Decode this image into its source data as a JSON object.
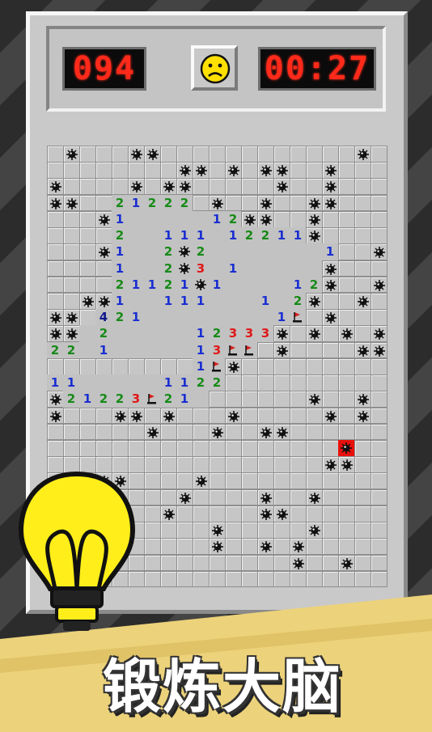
{
  "header": {
    "mine_counter": "094",
    "timer": "00:27",
    "face": "sad-face-icon"
  },
  "board": {
    "cols": 21,
    "rows": 27,
    "grid": [
      ".M...MM............M.",
      "........MM.M.MM..M...",
      "M....M.MM.....M..M...",
      "MM..21222.M..M..MM...",
      "...M1.....12MM..M....",
      "....2..111.12211M....",
      "...M1..2M2.......1..M",
      "....1..2M3.1.....M...",
      "....21121M1....12M..M",
      "..MM1..111...1.2M..M.",
      "MM.421........1F.M...",
      "MM.2.....12333M.M.M.M",
      "22.1.....13FF.M....MM",
      ".........1FM.........",
      "11.....1122..........",
      "M21223F21.......M..M.",
      "M...MM.M...M.....M.M.",
      "......M...M..MM......",
      "..................X..",
      ".................MM..",
      "...MM....M...........",
      "...M....M....M..M.....",
      ".......M.....MM......",
      "..........M.....M...",
      "..........M..M.M.....",
      "...............M..M..",
      "....................."
    ],
    "open_regions": [
      [
        3,
        4,
        8
      ],
      [
        4,
        4,
        9
      ],
      [
        5,
        4,
        15
      ],
      [
        6,
        4,
        16
      ],
      [
        7,
        4,
        16
      ],
      [
        8,
        4,
        16
      ],
      [
        9,
        4,
        15
      ],
      [
        10,
        3,
        15
      ],
      [
        11,
        2,
        13
      ],
      [
        12,
        0,
        12
      ],
      [
        13,
        9,
        10
      ],
      [
        14,
        0,
        10
      ],
      [
        15,
        1,
        9
      ]
    ]
  },
  "colors": {
    "one": "#1a2fd0",
    "two": "#178a17",
    "three": "#e01818",
    "four": "#101a8a",
    "mine": "#111111",
    "flag": "#d8201c",
    "led": "#ff2a1a",
    "bulb": "#ffee1a"
  },
  "banner": {
    "icon": "lightbulb-icon",
    "slogan": "锻炼大脑"
  }
}
